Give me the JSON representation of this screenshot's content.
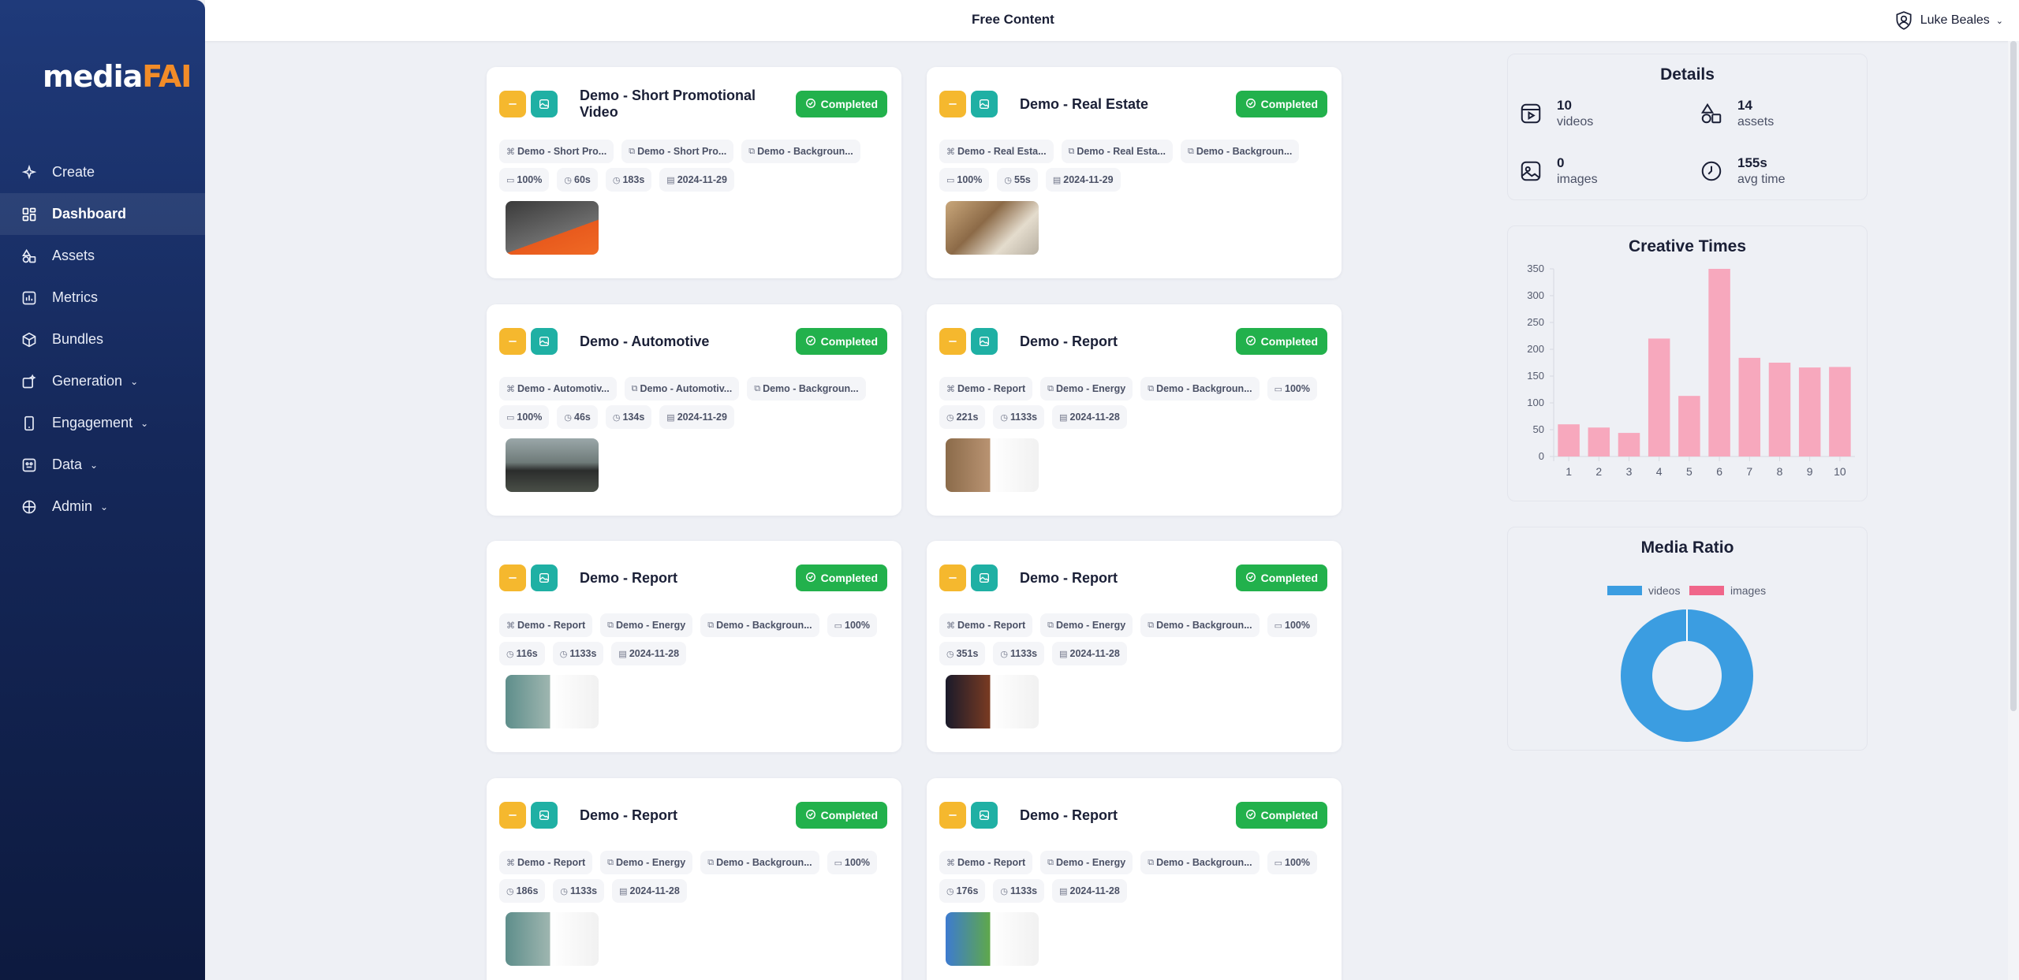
{
  "app": {
    "logo_main": "media",
    "logo_accent": "FAI",
    "page_title": "Free Content"
  },
  "user": {
    "name": "Luke Beales"
  },
  "sidebar": {
    "items": [
      {
        "label": "Create",
        "icon": "sparkle-icon"
      },
      {
        "label": "Dashboard",
        "icon": "grid-icon",
        "active": true
      },
      {
        "label": "Assets",
        "icon": "shapes-icon"
      },
      {
        "label": "Metrics",
        "icon": "chart-icon"
      },
      {
        "label": "Bundles",
        "icon": "box-icon"
      },
      {
        "label": "Generation",
        "icon": "wand-icon",
        "expandable": true
      },
      {
        "label": "Engagement",
        "icon": "phone-icon",
        "expandable": true
      },
      {
        "label": "Data",
        "icon": "database-icon",
        "expandable": true
      },
      {
        "label": "Admin",
        "icon": "shield-icon",
        "expandable": true
      }
    ]
  },
  "cards": [
    {
      "title": "Demo - Short Promotional Video",
      "status": "Completed",
      "row1": [
        "Demo - Short Pro...",
        "Demo - Short Pro...",
        "Demo - Backgroun..."
      ],
      "row2": [
        "100%",
        "60s",
        "183s",
        "2024-11-29"
      ]
    },
    {
      "title": "Demo - Real Estate",
      "status": "Completed",
      "row1": [
        "Demo - Real Esta...",
        "Demo - Real Esta...",
        "Demo - Backgroun..."
      ],
      "row2": [
        "100%",
        "55s",
        "2024-11-29"
      ]
    },
    {
      "title": "Demo - Automotive",
      "status": "Completed",
      "row1": [
        "Demo - Automotiv...",
        "Demo - Automotiv...",
        "Demo - Backgroun..."
      ],
      "row2": [
        "100%",
        "46s",
        "134s",
        "2024-11-29"
      ]
    },
    {
      "title": "Demo - Report",
      "status": "Completed",
      "row1": [
        "Demo - Report",
        "Demo - Energy",
        "Demo - Backgroun...",
        "100%"
      ],
      "row2": [
        "221s",
        "1133s",
        "2024-11-28"
      ]
    },
    {
      "title": "Demo - Report",
      "status": "Completed",
      "row1": [
        "Demo - Report",
        "Demo - Energy",
        "Demo - Backgroun...",
        "100%"
      ],
      "row2": [
        "116s",
        "1133s",
        "2024-11-28"
      ]
    },
    {
      "title": "Demo - Report",
      "status": "Completed",
      "row1": [
        "Demo - Report",
        "Demo - Energy",
        "Demo - Backgroun...",
        "100%"
      ],
      "row2": [
        "351s",
        "1133s",
        "2024-11-28"
      ]
    },
    {
      "title": "Demo - Report",
      "status": "Completed",
      "row1": [
        "Demo - Report",
        "Demo - Energy",
        "Demo - Backgroun...",
        "100%"
      ],
      "row2": [
        "186s",
        "1133s",
        "2024-11-28"
      ]
    },
    {
      "title": "Demo - Report",
      "status": "Completed",
      "row1": [
        "Demo - Report",
        "Demo - Energy",
        "Demo - Backgroun...",
        "100%"
      ],
      "row2": [
        "176s",
        "1133s",
        "2024-11-28"
      ]
    }
  ],
  "details": {
    "title": "Details",
    "videos": {
      "value": "10",
      "label": "videos"
    },
    "assets": {
      "value": "14",
      "label": "assets"
    },
    "images": {
      "value": "0",
      "label": "images"
    },
    "avg_time": {
      "value": "155s",
      "label": "avg time"
    }
  },
  "chart_data": [
    {
      "type": "bar",
      "title": "Creative Times",
      "categories": [
        "1",
        "2",
        "3",
        "4",
        "5",
        "6",
        "7",
        "8",
        "9",
        "10"
      ],
      "values": [
        60,
        54,
        44,
        220,
        113,
        350,
        184,
        175,
        166,
        167
      ],
      "ylim": [
        0,
        350
      ],
      "yticks": [
        0,
        50,
        100,
        150,
        200,
        250,
        300,
        350
      ],
      "color": "#f7a8bd",
      "grid": false,
      "legend": false
    },
    {
      "type": "pie",
      "title": "Media Ratio",
      "donut": true,
      "labels": [
        "videos",
        "images"
      ],
      "values": [
        10,
        0
      ],
      "colors": [
        "#3b9de1",
        "#f0668a"
      ],
      "legend": "top"
    }
  ],
  "colors": {
    "completed": "#22b14c",
    "accent_yellow": "#f5b82e",
    "accent_teal": "#1fb0a4"
  }
}
